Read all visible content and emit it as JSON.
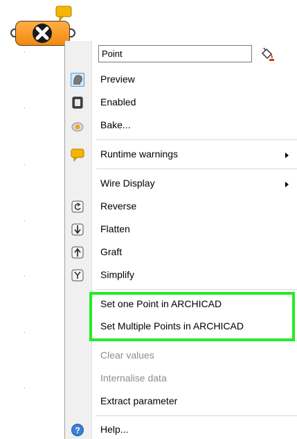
{
  "component": {
    "name": "Point",
    "icon": "point-param-icon",
    "warning_icon": "runtime-warning-balloon-icon",
    "colors": {
      "body": "#f08a12",
      "outline": "#5a3410",
      "warning": "#f7b500"
    }
  },
  "menu": {
    "name_field_value": "Point",
    "name_field_icon": "paint-bucket-icon",
    "items": [
      {
        "label": "Preview",
        "icon": "preview-icon"
      },
      {
        "label": "Enabled",
        "icon": "enabled-icon"
      },
      {
        "label": "Bake...",
        "icon": "bake-icon"
      },
      {
        "label": "Runtime warnings",
        "icon": "warning-balloon-icon"
      },
      {
        "label": "Wire Display"
      },
      {
        "label": "Reverse",
        "icon": "reverse-icon"
      },
      {
        "label": "Flatten",
        "icon": "flatten-icon"
      },
      {
        "label": "Graft",
        "icon": "graft-icon"
      },
      {
        "label": "Simplify",
        "icon": "simplify-icon"
      },
      {
        "label": "Set one Point in ARCHICAD"
      },
      {
        "label": "Set Multiple Points in ARCHICAD"
      },
      {
        "label": "Clear values",
        "disabled": true
      },
      {
        "label": "Internalise data",
        "disabled": true
      },
      {
        "label": "Extract parameter"
      },
      {
        "label": "Help...",
        "icon": "help-icon"
      }
    ],
    "highlight_color": "#22ee22"
  }
}
